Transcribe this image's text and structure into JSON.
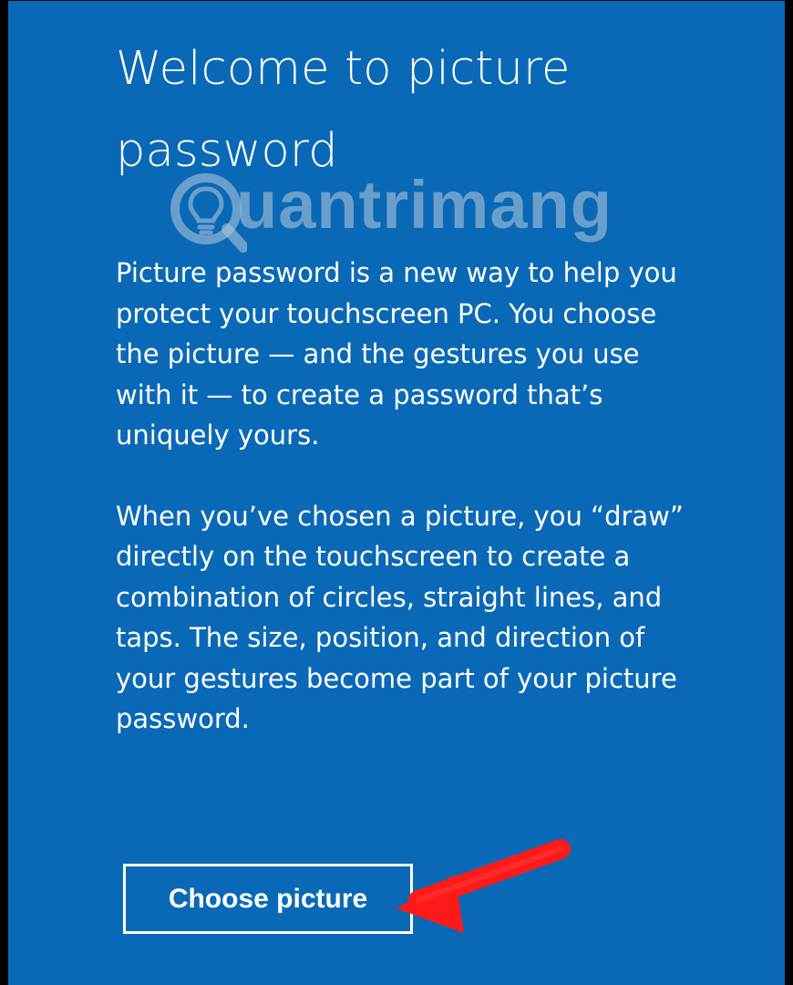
{
  "dialog": {
    "title": "Welcome to picture password",
    "paragraph_1": "Picture password is a new way to help you protect your touchscreen PC. You choose the picture — and the gestures you use with it — to create a password that’s uniquely yours.",
    "paragraph_2": "When you’ve chosen a picture, you “draw” directly on the touchscreen to create a combination of circles, straight lines, and taps. The size, position, and direction of your gestures become part of your picture password.",
    "choose_button_label": "Choose picture"
  },
  "watermark": {
    "text": "uantrimang",
    "icon": "lightbulb-in-q-icon"
  },
  "annotation": {
    "arrow_icon": "red-arrow-icon",
    "color": "#ff1a1a"
  },
  "colors": {
    "background": "#0a69b7",
    "text": "#ffffff",
    "border": "#000000"
  }
}
